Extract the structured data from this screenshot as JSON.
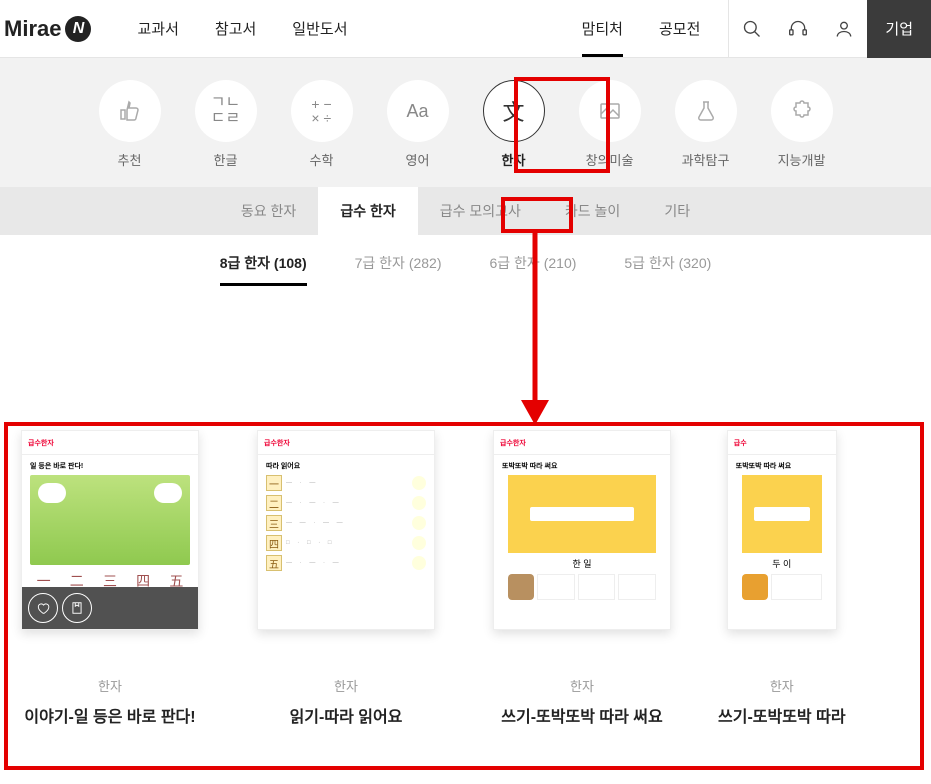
{
  "header": {
    "logo_text": "Mirae",
    "logo_badge": "N",
    "nav": [
      "교과서",
      "참고서",
      "일반도서"
    ],
    "subnav": [
      {
        "label": "맘티처",
        "active": true
      },
      {
        "label": "공모전",
        "active": false
      }
    ],
    "cta": "기업"
  },
  "categories": [
    {
      "icon": "👍",
      "label": "추천"
    },
    {
      "icon": "ㄱㄴ",
      "label": "한글"
    },
    {
      "icon": "+−×÷",
      "label": "수학"
    },
    {
      "icon": "Aa",
      "label": "영어"
    },
    {
      "icon": "文",
      "label": "한자",
      "selected": true
    },
    {
      "icon": "🖼",
      "label": "창의미술"
    },
    {
      "icon": "🧪",
      "label": "과학탐구"
    },
    {
      "icon": "🧩",
      "label": "지능개발"
    }
  ],
  "tabs": [
    {
      "label": "동요 한자"
    },
    {
      "label": "급수 한자",
      "active": true
    },
    {
      "label": "급수 모의고사"
    },
    {
      "label": "카드 놀이"
    },
    {
      "label": "기타"
    }
  ],
  "levels": [
    {
      "label": "8급 한자 (108)",
      "active": true
    },
    {
      "label": "7급 한자 (282)"
    },
    {
      "label": "6급 한자 (210)"
    },
    {
      "label": "5급 한자 (320)"
    }
  ],
  "cards": [
    {
      "cat": "한자",
      "title": "이야기-일 등은 바로 판다!",
      "thumb": {
        "title": "일 등은 바로 판다!",
        "chars": [
          "一",
          "二",
          "三",
          "四",
          "五"
        ]
      }
    },
    {
      "cat": "한자",
      "title": "읽기-따라 읽어요",
      "thumb": {
        "title": "따라 읽어요",
        "chars": [
          "一",
          "二",
          "三",
          "四",
          "五"
        ]
      }
    },
    {
      "cat": "한자",
      "title": "쓰기-또박또박 따라 써요",
      "thumb": {
        "title": "또박또박 따라 써요",
        "big": "한 일"
      }
    },
    {
      "cat": "한자",
      "title": "쓰기-또박또박 따라",
      "thumb": {
        "title": "또박또박 따라 써요",
        "big": "두 이"
      }
    }
  ]
}
